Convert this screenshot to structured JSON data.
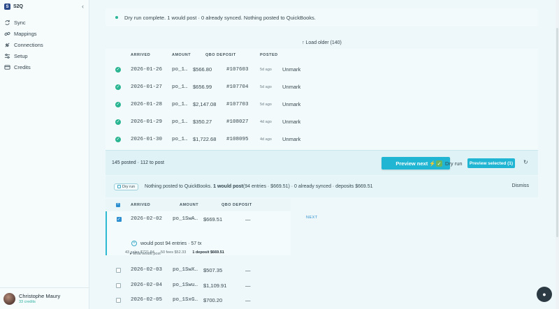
{
  "app": {
    "name": "S2Q",
    "logo": "S"
  },
  "sidebar": {
    "items": [
      {
        "label": "Sync",
        "icon": "sync-icon"
      },
      {
        "label": "Mappings",
        "icon": "link-icon"
      },
      {
        "label": "Connections",
        "icon": "plug-icon"
      },
      {
        "label": "Setup",
        "icon": "sliders-icon"
      },
      {
        "label": "Credits",
        "icon": "card-icon"
      }
    ],
    "user": {
      "name": "Christophe Maury",
      "credits": "33 credits"
    }
  },
  "banner": {
    "text": "Dry run complete. 1 would post · 0 already synced. Nothing posted to QuickBooks."
  },
  "load_older": "↑ Load older (140)",
  "posted_table": {
    "headers": [
      "ARRIVED",
      "AMOUNT",
      "QBO DEPOSIT",
      "POSTED"
    ],
    "rows": [
      {
        "date": "2026-01-26",
        "po": "po_1…",
        "amount": "$566.80",
        "deposit": "#107603",
        "ago": "5d ago",
        "action": "Unmark"
      },
      {
        "date": "2026-01-27",
        "po": "po_1…",
        "amount": "$656.99",
        "deposit": "#107704",
        "ago": "5d ago",
        "action": "Unmark"
      },
      {
        "date": "2026-01-28",
        "po": "po_1…",
        "amount": "$2,147.08",
        "deposit": "#107703",
        "ago": "5d ago",
        "action": "Unmark"
      },
      {
        "date": "2026-01-29",
        "po": "po_1…",
        "amount": "$350.27",
        "deposit": "#108027",
        "ago": "4d ago",
        "action": "Unmark"
      },
      {
        "date": "2026-01-30",
        "po": "po_1…",
        "amount": "$1,722.68",
        "deposit": "#108095",
        "ago": "4d ago",
        "action": "Unmark"
      }
    ]
  },
  "action_bar": {
    "summary": "145 posted · 112 to post",
    "preview_next": "Preview next ⚡",
    "dry_run": "Dry run",
    "preview_selected": "Preview selected (1)"
  },
  "dry_bar": {
    "tag": "Dry run",
    "prefix": "Nothing posted to QuickBooks.",
    "strong": "1 would post",
    "rest": "(94 entries · $669.51) · 0 already synced · deposits $669.51",
    "dismiss": "Dismiss"
  },
  "pending_table": {
    "headers": [
      "ARRIVED",
      "AMOUNT",
      "QBO DEPOSIT"
    ],
    "selected": {
      "date": "2026-02-02",
      "po": "po_1SwA…",
      "amount": "$669.51",
      "deposit": "—",
      "badge": "NEXT",
      "would": "would post 94 entries · 57 tx",
      "chips": {
        "sales": "43 sales $721.84",
        "fees": "50 fees $52.33",
        "deposit": "1 deposit $669.51"
      },
      "what": "▸ what would post"
    },
    "rows": [
      {
        "date": "2026-02-03",
        "po": "po_1SwX…",
        "amount": "$507.35",
        "deposit": "—"
      },
      {
        "date": "2026-02-04",
        "po": "po_1Swu…",
        "amount": "$1,109.91",
        "deposit": "—"
      },
      {
        "date": "2026-02-05",
        "po": "po_1SxG…",
        "amount": "$700.20",
        "deposit": "—"
      }
    ]
  },
  "colors": {
    "accent": "#1fb5d3",
    "success": "#29b592",
    "brand": "#2a4a8a"
  }
}
